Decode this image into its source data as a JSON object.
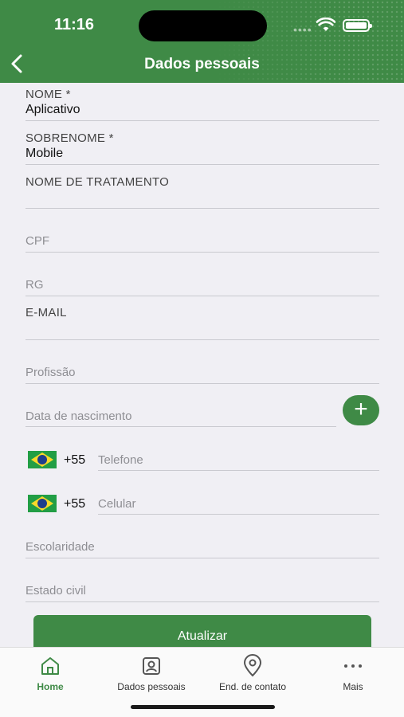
{
  "status": {
    "time": "11:16"
  },
  "header": {
    "title": "Dados pessoais"
  },
  "form": {
    "nome_label": "NOME *",
    "nome_value": "Aplicativo",
    "sobrenome_label": "SOBRENOME *",
    "sobrenome_value": "Mobile",
    "tratamento_label": "NOME DE TRATAMENTO",
    "cpf_placeholder": "CPF",
    "rg_placeholder": "RG",
    "email_label": "E-MAIL",
    "profissao_placeholder": "Profissão",
    "nascimento_placeholder": "Data de nascimento",
    "add_label": "+",
    "phone_code": "+55",
    "telefone_placeholder": "Telefone",
    "celular_code": "+55",
    "celular_placeholder": "Celular",
    "escolaridade_placeholder": "Escolaridade",
    "estado_civil_placeholder": "Estado civil",
    "update_label": "Atualizar"
  },
  "tabbar": {
    "items": [
      {
        "label": "Home",
        "icon": "home-icon",
        "active": true
      },
      {
        "label": "Dados pessoais",
        "icon": "id-card-icon"
      },
      {
        "label": "End. de contato",
        "icon": "location-pin-icon"
      },
      {
        "label": "Mais",
        "icon": "more-dots-icon"
      }
    ]
  },
  "colors": {
    "brand": "#3f8a46",
    "background": "#f0eff4"
  }
}
